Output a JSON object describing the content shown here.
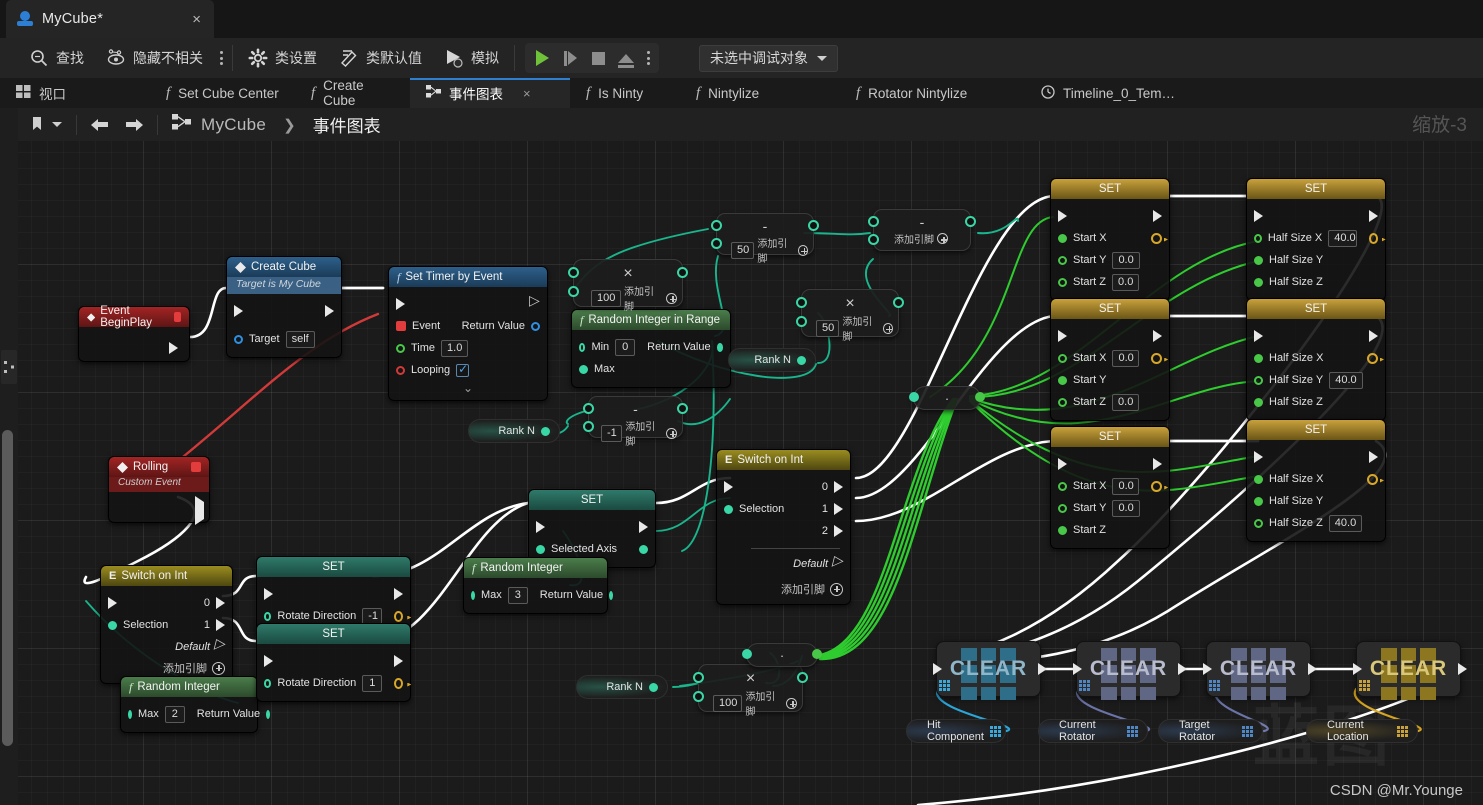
{
  "window": {
    "tab_title": "MyCube*",
    "close": "×"
  },
  "toolbar": {
    "find": "查找",
    "hide_unrelated": "隐藏不相关",
    "class_settings": "类设置",
    "class_defaults": "类默认值",
    "simulate": "模拟",
    "debug_object": "未选中调试对象"
  },
  "doc_tabs": [
    {
      "label": "视口",
      "icon": "viewport-icon",
      "active": false
    },
    {
      "label": "Set Cube Center",
      "icon": "function-icon",
      "active": false
    },
    {
      "label": "Create Cube",
      "icon": "function-icon",
      "active": false
    },
    {
      "label": "事件图表",
      "icon": "graph-icon",
      "active": true,
      "close": "×"
    },
    {
      "label": "Is Ninty",
      "icon": "function-icon",
      "active": false
    },
    {
      "label": "Nintylize",
      "icon": "function-icon",
      "active": false
    },
    {
      "label": "Rotator Nintylize",
      "icon": "function-icon",
      "active": false
    },
    {
      "label": "Timeline_0_Tem…",
      "icon": "clock-icon",
      "active": false
    }
  ],
  "breadcrumb": {
    "root": "MyCube",
    "separator": "❯",
    "current": "事件图表"
  },
  "graph": {
    "zoom_label": "缩放-3",
    "watermark": "蓝图",
    "credit": "CSDN @Mr.Younge",
    "add_pin": "添加引脚",
    "nodes": {
      "event_begin_play": {
        "title": "Event BeginPlay"
      },
      "create_cube": {
        "title": "Create Cube",
        "subtitle": "Target is My Cube",
        "pin_target": "Target",
        "target_value": "self"
      },
      "set_timer": {
        "title": "Set Timer by Event",
        "pin_event": "Event",
        "pin_time": "Time",
        "time_value": "1.0",
        "pin_looping": "Looping",
        "pin_return": "Return Value"
      },
      "random_int_range": {
        "title": "Random Integer in Range",
        "pin_min": "Min",
        "min_value": "0",
        "pin_max": "Max",
        "pin_return": "Return Value"
      },
      "rolling": {
        "title": "Rolling",
        "subtitle": "Custom Event"
      },
      "switch_int_left": {
        "title": "Switch on Int",
        "pin_selection": "Selection",
        "out0": "0",
        "out1": "1",
        "default": "Default"
      },
      "switch_int_mid": {
        "title": "Switch on Int",
        "pin_selection": "Selection",
        "out0": "0",
        "out1": "1",
        "out2": "2",
        "default": "Default"
      },
      "random_int_left": {
        "title": "Random Integer",
        "pin_max": "Max",
        "max_value": "2",
        "pin_return": "Return Value"
      },
      "random_int_mid": {
        "title": "Random Integer",
        "pin_max": "Max",
        "max_value": "3",
        "pin_return": "Return Value"
      },
      "set_rotate_dir_a": {
        "title": "SET",
        "pin": "Rotate Direction",
        "value": "-1"
      },
      "set_rotate_dir_b": {
        "title": "SET",
        "pin": "Rotate Direction",
        "value": "1"
      },
      "set_selected_axis": {
        "title": "SET",
        "pin": "Selected Axis"
      },
      "set_start_1": {
        "title": "SET",
        "p1": "Start X",
        "p2": "Start Y",
        "v2": "0.0",
        "p3": "Start Z",
        "v3": "0.0"
      },
      "set_start_2": {
        "title": "SET",
        "p1": "Start X",
        "v1": "0.0",
        "p2": "Start Y",
        "p3": "Start Z",
        "v3": "0.0"
      },
      "set_start_3": {
        "title": "SET",
        "p1": "Start X",
        "v1": "0.0",
        "p2": "Start Y",
        "v2": "0.0",
        "p3": "Start Z"
      },
      "set_half_1": {
        "title": "SET",
        "p1": "Half Size X",
        "v1": "40.0",
        "p2": "Half Size Y",
        "p3": "Half Size Z"
      },
      "set_half_2": {
        "title": "SET",
        "p1": "Half Size X",
        "p2": "Half Size Y",
        "v2": "40.0",
        "p3": "Half Size Z"
      },
      "set_half_3": {
        "title": "SET",
        "p1": "Half Size X",
        "p2": "Half Size Y",
        "p3": "Half Size Z",
        "v3": "40.0"
      },
      "math_mul_100_a": {
        "op": "×",
        "value": "100"
      },
      "math_sub_50_a": {
        "op": "-",
        "value": "50"
      },
      "math_sub_b": {
        "op": "-",
        "value": ""
      },
      "math_mul_50_a": {
        "op": "×",
        "value": "50"
      },
      "math_sub_neg1": {
        "op": "-",
        "value": "-1"
      },
      "math_mul_100_b": {
        "op": "×",
        "value": "100"
      },
      "conv_a": {
        "op": "·"
      },
      "conv_b": {
        "op": "·"
      }
    },
    "vars": {
      "rank_n_1": "Rank N",
      "rank_n_2": "Rank N",
      "rank_n_3": "Rank N",
      "hit_component": "Hit Component",
      "current_rotator": "Current Rotator",
      "target_rotator": "Target Rotator",
      "current_location": "Current Location"
    },
    "timelines": [
      {
        "label": "CLEAR",
        "variant": "cyan"
      },
      {
        "label": "CLEAR",
        "variant": "purple"
      },
      {
        "label": "CLEAR",
        "variant": "purple"
      },
      {
        "label": "CLEAR",
        "variant": "gold"
      }
    ]
  },
  "colors": {
    "exec_wire": "#ffffff",
    "event_wire": "#d23a3a",
    "float_wire": "#49c749",
    "int_wire": "#3ad7a6",
    "accent_tab": "#2f7fd0"
  }
}
